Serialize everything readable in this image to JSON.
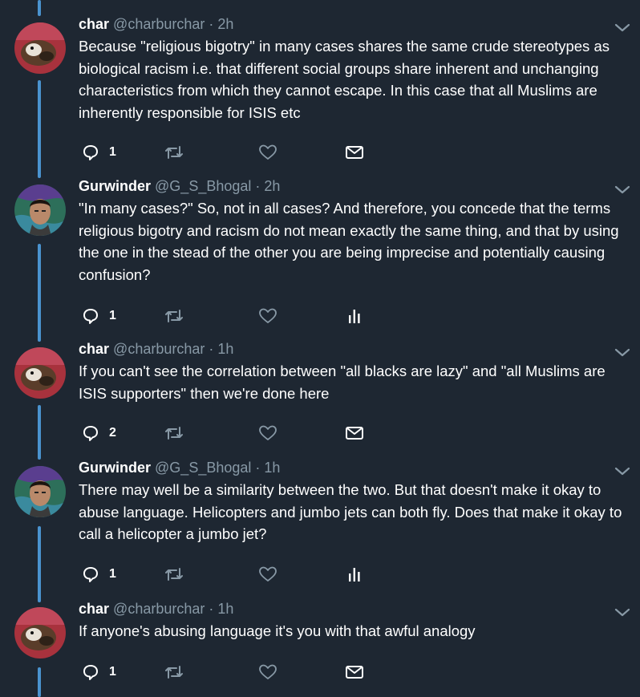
{
  "colors": {
    "background": "#1e2732",
    "thread_line": "#4a93cf",
    "text": "#ffffff",
    "muted": "#8899a6"
  },
  "tweets": [
    {
      "name": "char",
      "handle": "@charburchar",
      "dot": "·",
      "time": "2h",
      "text": "Because \"religious bigotry\" in many cases shares the same crude stereotypes as biological racism i.e. that different social groups share inherent and unchanging characteristics from which they cannot escape. In this case that all Muslims are inherently responsible for ISIS etc",
      "reply_count": "1",
      "last_action_icon": "mail-icon"
    },
    {
      "name": "Gurwinder",
      "handle": "@G_S_Bhogal",
      "dot": "·",
      "time": "2h",
      "text": "\"In many cases?\" So, not in all cases? And therefore, you concede that the terms religious bigotry and racism do not mean exactly the same thing, and that by using the one in the stead of the other you are being imprecise and potentially causing confusion?",
      "reply_count": "1",
      "last_action_icon": "analytics-icon"
    },
    {
      "name": "char",
      "handle": "@charburchar",
      "dot": "·",
      "time": "1h",
      "text": "If you can't see the correlation between \"all blacks are lazy\" and \"all Muslims are ISIS supporters\" then we're done here",
      "reply_count": "2",
      "last_action_icon": "mail-icon"
    },
    {
      "name": "Gurwinder",
      "handle": "@G_S_Bhogal",
      "dot": "·",
      "time": "1h",
      "text": "There may well be a similarity between the two. But that doesn't make it okay to abuse language. Helicopters and jumbo jets can both fly. Does that make it okay to call a helicopter a jumbo jet?",
      "reply_count": "1",
      "last_action_icon": "analytics-icon"
    },
    {
      "name": "char",
      "handle": "@charburchar",
      "dot": "·",
      "time": "1h",
      "text": "If anyone's abusing language it's you with that awful analogy",
      "reply_count": "1",
      "last_action_icon": "mail-icon"
    }
  ]
}
